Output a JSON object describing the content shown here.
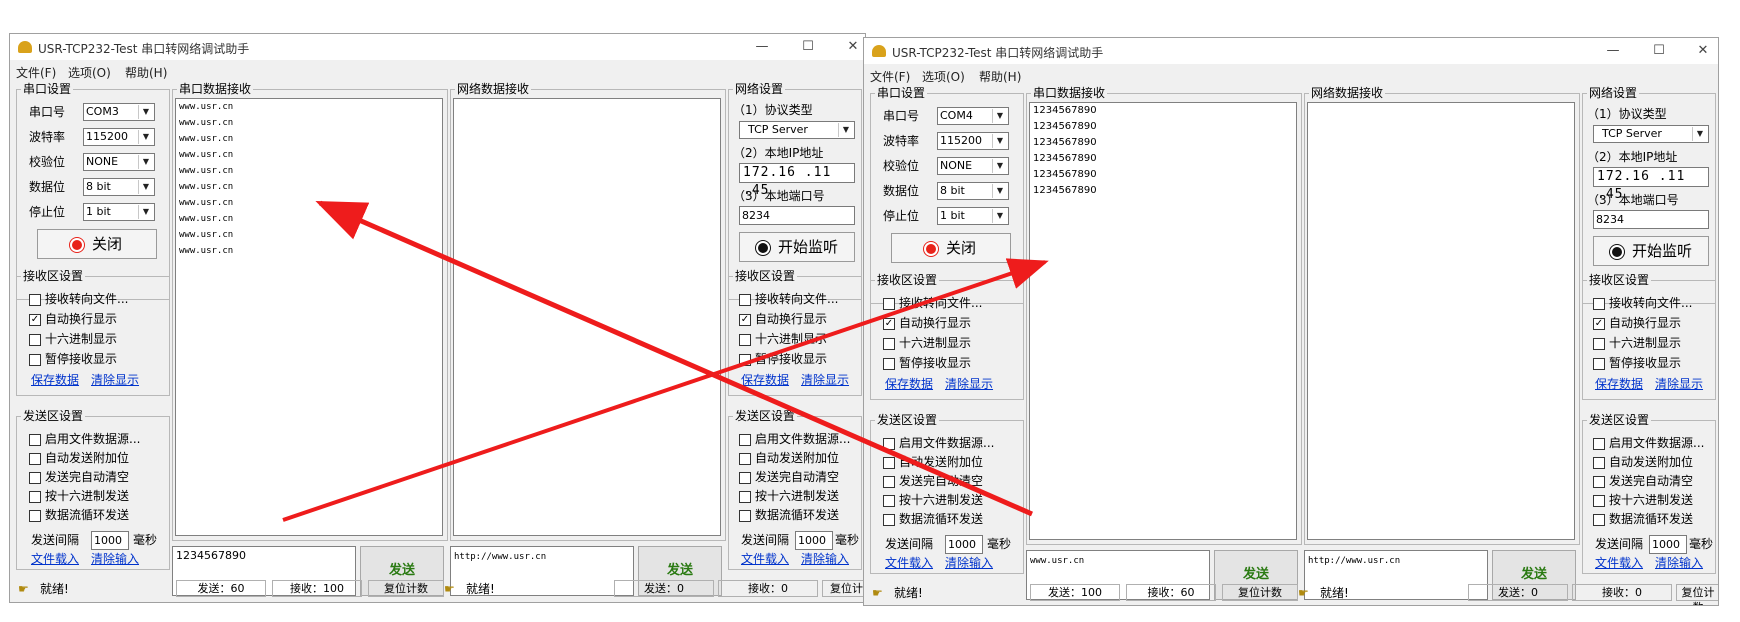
{
  "app_title": "USR-TCP232-Test 串口转网络调试助手",
  "menu": [
    "文件(F)",
    "选项(O)",
    "帮助(H)"
  ],
  "window_controls": [
    "—",
    "☐",
    "✕"
  ],
  "serial_settings": {
    "title": "串口设置",
    "port_label": "串口号",
    "baud_label": "波特率",
    "parity_label": "校验位",
    "databits_label": "数据位",
    "stopbits_label": "停止位",
    "close_label": "关闭"
  },
  "serial_recv_title": "串口数据接收",
  "net_recv_title": "网络数据接收",
  "net_settings": {
    "title": "网络设置",
    "protocol_label": "（1）协议类型",
    "protocol_value": "TCP Server",
    "ip_label": "（2）本地IP地址",
    "ip_value": "172.16 .11 .45",
    "port_label": "（3）本地端口号",
    "port_value": "8234",
    "listen_label": "开始监听"
  },
  "recv_settings": {
    "title": "接收区设置",
    "options": [
      "接收转向文件...",
      "自动换行显示",
      "十六进制显示",
      "暂停接收显示"
    ],
    "save_link": "保存数据",
    "clear_link": "清除显示"
  },
  "send_settings": {
    "title": "发送区设置",
    "options": [
      "启用文件数据源...",
      "自动发送附加位",
      "发送完自动清空",
      "按十六进制发送",
      "数据流循环发送"
    ],
    "interval_label": "发送间隔",
    "interval_value": "1000",
    "interval_unit": "毫秒",
    "load_link": "文件载入",
    "clear_link": "清除输入"
  },
  "send_button": "发送",
  "status_ready": "就绪!",
  "reset_count": "复位计数",
  "left": {
    "port": "COM3",
    "baud": "115200",
    "parity": "NONE",
    "databits": "8 bit",
    "stopbits": "1 bit",
    "serial_recv_lines": [
      "www.usr.cn",
      "www.usr.cn",
      "www.usr.cn",
      "www.usr.cn",
      "www.usr.cn",
      "www.usr.cn",
      "www.usr.cn",
      "www.usr.cn",
      "www.usr.cn",
      "www.usr.cn"
    ],
    "serial_send_text": "1234567890",
    "net_send_text": "http://www.usr.cn",
    "serial_sent": "发送：60",
    "serial_recv_count": "接收：100",
    "net_sent": "发送：0",
    "net_recv_count": "接收：0"
  },
  "right": {
    "port": "COM4",
    "baud": "115200",
    "parity": "NONE",
    "databits": "8 bit",
    "stopbits": "1 bit",
    "serial_recv_lines": [
      "1234567890",
      "1234567890",
      "1234567890",
      "1234567890",
      "1234567890",
      "1234567890"
    ],
    "serial_send_text": "www.usr.cn",
    "net_send_text": "http://www.usr.cn",
    "serial_sent": "发送：100",
    "serial_recv_count": "接收：60",
    "net_sent": "发送：0",
    "net_recv_count": "接收：0"
  },
  "checked_recv": [
    false,
    true,
    false,
    false
  ],
  "colors": {
    "arrow": "#ee1c1c",
    "link": "#0033cc",
    "send_text": "#2a7a12"
  }
}
